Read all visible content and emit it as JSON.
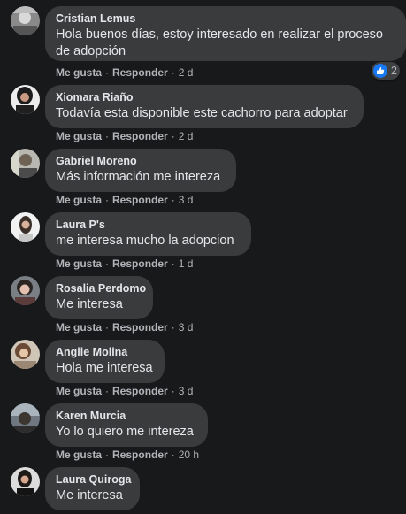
{
  "actions": {
    "like_label": "Me gusta",
    "reply_label": "Responder",
    "separator": "·"
  },
  "comments": [
    {
      "author": "Cristian Lemus",
      "text": "Hola buenos días, estoy interesado en realizar el proceso de adopción",
      "time": "2 d",
      "reactions": {
        "icon": "like-icon",
        "count": "2"
      }
    },
    {
      "author": "Xiomara Riaño",
      "text": "Todavía esta disponible este cachorro para adoptar",
      "time": "2 d"
    },
    {
      "author": "Gabriel Moreno",
      "text": "Más información me intereza",
      "time": "3 d"
    },
    {
      "author": "Laura P's",
      "text": "me interesa mucho la adopcion",
      "time": "1 d"
    },
    {
      "author": "Rosalia Perdomo",
      "text": "Me interesa",
      "time": "3 d"
    },
    {
      "author": "Angiie Molina",
      "text": "Hola me interesa",
      "time": "3 d"
    },
    {
      "author": "Karen Murcia",
      "text": "Yo lo quiero me intereza",
      "time": "20 h"
    },
    {
      "author": "Laura Quiroga",
      "text": "Me interesa",
      "time": ""
    }
  ],
  "colors": {
    "background": "#18191a",
    "bubble": "#3a3b3c",
    "secondary_text": "#b0b3b8",
    "like_blue": "#1877f2"
  }
}
